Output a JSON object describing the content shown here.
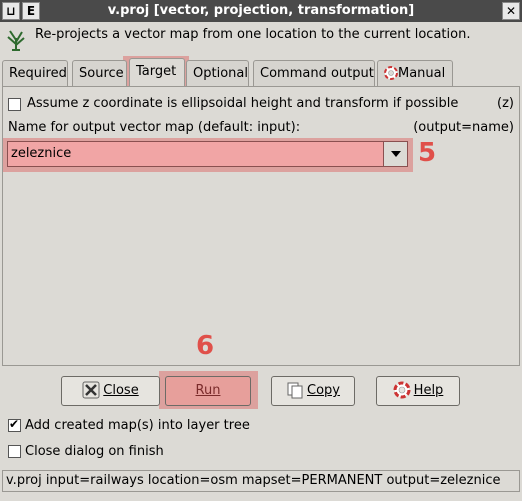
{
  "window": {
    "title": "v.proj [vector, projection, transformation]",
    "left_btn1": "⊔",
    "left_btn2": "E",
    "close_btn": "✕"
  },
  "description": "Re-projects a vector map from one location to the current location.",
  "tabs": [
    {
      "label": "Required"
    },
    {
      "label": "Source"
    },
    {
      "label": "Target",
      "active": true
    },
    {
      "label": "Optional"
    },
    {
      "label": "Command output"
    },
    {
      "label": "Manual"
    }
  ],
  "options": {
    "zcoord_label": "Assume z coordinate is ellipsoidal height and transform if possible",
    "zcoord_flag": "(z)",
    "zcoord_checked": false,
    "output_label": "Name for output vector map (default: input):",
    "output_hint": "(output=name)",
    "output_value": "zeleznice"
  },
  "annotations": {
    "step5": "5",
    "step6": "6"
  },
  "buttons": {
    "close": "Close",
    "run": "Run",
    "copy": "Copy",
    "help": "Help"
  },
  "footer": {
    "add_maps_label": "Add created map(s) into layer tree",
    "add_maps_checked": true,
    "close_dialog_label": "Close dialog on finish",
    "close_dialog_checked": false
  },
  "command_line": "v.proj input=railways location=osm mapset=PERMANENT output=zeleznice",
  "colors": {
    "highlight": "#e0504a",
    "window_bg": "#dcdad5",
    "titlebar": "#4a4a4a"
  }
}
